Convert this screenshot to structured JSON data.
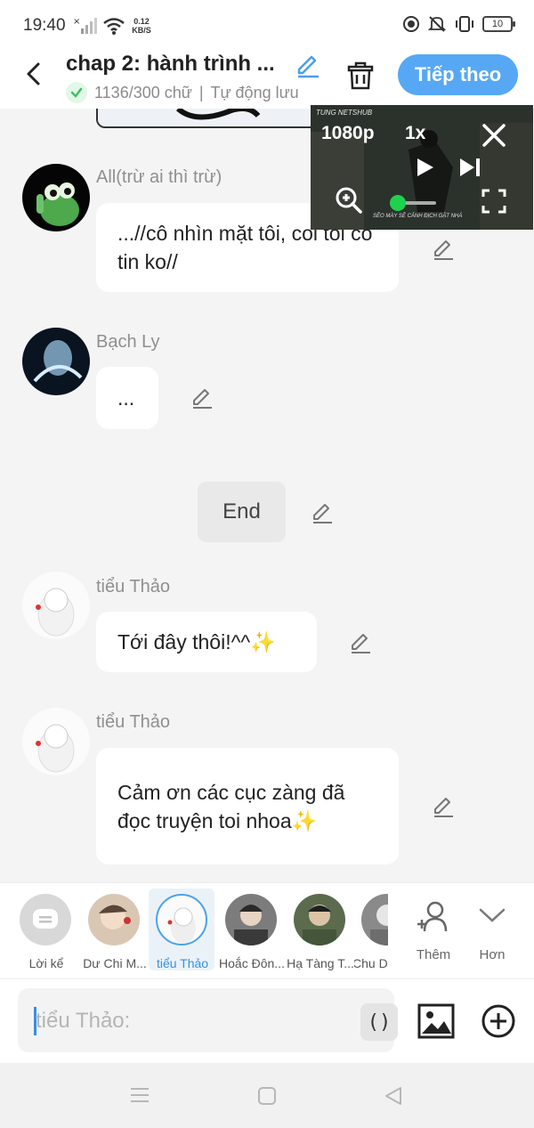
{
  "status_bar": {
    "time": "19:40",
    "net_speed_value": "0.12",
    "net_speed_unit": "KB/S",
    "battery": "10",
    "icons": [
      "signal-x-icon",
      "wifi-icon",
      "record-icon",
      "mute-icon",
      "vibrate-icon",
      "battery-icon"
    ]
  },
  "header": {
    "title": "chap 2: hành trình ...",
    "word_count": "1136/300 chữ",
    "separator": "|",
    "autosave": "Tự động lưu",
    "next_button": "Tiếp theo",
    "accent_color": "#56a8f5"
  },
  "messages": [
    {
      "name": "All(trừ ai thì trừ)",
      "text": "...//cô nhìn mặt tôi, coi tôi có tin ko//"
    },
    {
      "name": "Bạch Ly",
      "text": "..."
    },
    {
      "narration": "End"
    },
    {
      "name": "tiểu Thảo",
      "text": "Tới đây thôi!^^✨"
    },
    {
      "name": "tiểu Thảo",
      "text": "Cảm ơn các cục zàng đã đọc truyện toi nhoa✨"
    }
  ],
  "video_overlay": {
    "quality": "1080p",
    "speed": "1x",
    "watermark_top": "TUNG NETSHUB",
    "caption": "SẼO MÀY SẼ CẢNH ĐỊCH GẶT NHÁ"
  },
  "characters": [
    {
      "label": "Lời kể",
      "selected": false
    },
    {
      "label": "Dư Chi M...",
      "selected": false
    },
    {
      "label": "tiểu Thảo",
      "selected": true
    },
    {
      "label": "Hoắc Đôn...",
      "selected": false
    },
    {
      "label": "Hạ Tàng T...",
      "selected": false
    },
    {
      "label": "Chu D",
      "selected": false
    }
  ],
  "utilities": {
    "add_label": "Thêm",
    "more_label": "Hơn"
  },
  "input": {
    "placeholder": "tiểu Thảo:",
    "paren_button": "()"
  },
  "colors": {
    "selected": "#3590e3",
    "bubble": "#ffffff",
    "background": "#f4f4f4",
    "check": "#3cc26a"
  }
}
